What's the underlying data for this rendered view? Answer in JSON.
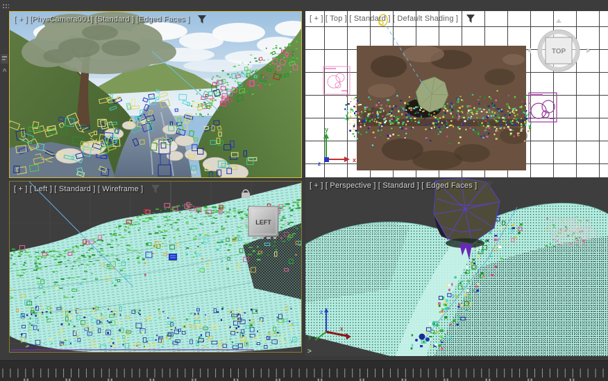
{
  "viewports": {
    "camera": {
      "label": "[ + ] [PhysCamera001] [Standard ] [Edged Faces ]"
    },
    "top": {
      "label": "[ + ] [ Top ] [ Standard ] [ Default Shading ]",
      "viewcube_label": "TOP"
    },
    "left": {
      "label": "[ + ] [ Left ] [ Standard ] [ Wireframe ]",
      "viewcube_label": "LEFT"
    },
    "perspective": {
      "label": "[ + ] [ Perspective ] [ Standard ] [ Edged Faces ]",
      "prompt_char": ">"
    }
  },
  "axis": {
    "x": "x",
    "y": "y",
    "z": "z"
  },
  "timeline": {
    "tick_count": 80
  },
  "colors": {
    "appBg": "#3a3a3a",
    "vpDarkBg": "#3e3e3e",
    "activeBorder": "#d6ba3a",
    "secondaryBorder": "#8c7c2c",
    "gridPaper": "#ffffff",
    "labelLight": "#d6d6d6",
    "labelDark": "#5c5c5c",
    "terrainCyan": "#b2ece1",
    "scatter": [
      "#2fb03c",
      "#58d048",
      "#1f9030",
      "#ded867",
      "#efe98a",
      "#cfc84f",
      "#2236b8",
      "#1a2a90",
      "#3cc8a8",
      "#58d8d8",
      "#e06898",
      "#d04880",
      "#c42020",
      "#e0a040"
    ]
  }
}
